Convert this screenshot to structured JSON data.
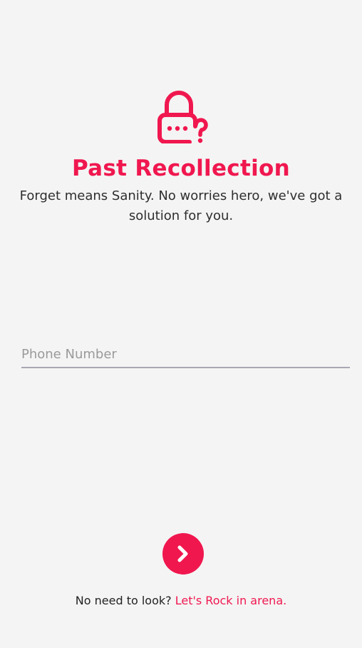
{
  "header": {
    "icon": "lock-question-icon",
    "title": "Past Recollection",
    "subtitle": "Forget means Sanity. No worries hero, we've got a solution for you."
  },
  "form": {
    "phone_placeholder": "Phone Number",
    "phone_value": ""
  },
  "actions": {
    "next_icon": "chevron-right-icon"
  },
  "footer": {
    "prompt": "No need to look?",
    "link_label": "Let's Rock in arena."
  },
  "colors": {
    "accent": "#f0174f",
    "background": "#f4f4f4",
    "text": "#2e2e2e",
    "placeholder": "#9a9a9a",
    "underline": "#a8a8b4"
  }
}
